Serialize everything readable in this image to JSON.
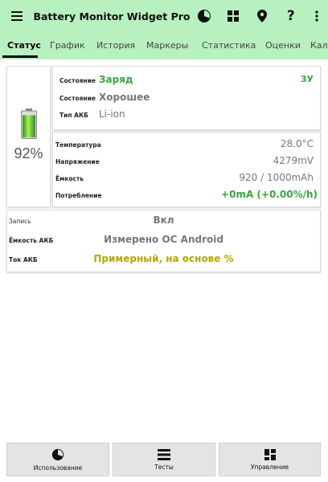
{
  "app": {
    "title": "Battery Monitor Widget Pro",
    "menu_icon": "hamburger-menu-icon",
    "actions": [
      {
        "icon": "pie-chart-icon"
      },
      {
        "icon": "widgets-grid-icon"
      },
      {
        "icon": "location-pin-icon"
      },
      {
        "label": "?",
        "icon": "help-icon"
      },
      {
        "icon": "more-vert-icon"
      }
    ],
    "accent_color": "#b8f0bf"
  },
  "tabs": [
    {
      "label": "Статус",
      "active": true
    },
    {
      "label": "График"
    },
    {
      "label": "История"
    },
    {
      "label": "Маркеры"
    },
    {
      "label": "Статистика"
    },
    {
      "label": "Оценки"
    },
    {
      "label": "Кал"
    }
  ],
  "battery": {
    "percent": "92%",
    "level": 0.92,
    "icon": "battery-icon"
  },
  "status": {
    "rows": [
      {
        "label": "Состояние",
        "value": "Заряд",
        "right": "ЗУ"
      },
      {
        "label": "Состояние",
        "value": "Хорошее"
      },
      {
        "label": "Тип АКБ",
        "value": "Li-ion"
      }
    ]
  },
  "params": {
    "rows": [
      {
        "label": "Температура",
        "value": "28.0°C"
      },
      {
        "label": "Напряжение",
        "value": "4279mV"
      },
      {
        "label": "Ёмкость",
        "value": "920 / 1000mAh"
      },
      {
        "label": "Потребление",
        "value": "+0mA (+0.00%/h)"
      }
    ]
  },
  "record": {
    "rows": [
      {
        "label": "Запись",
        "value": "Вкл"
      },
      {
        "label": "Ёмкость АКБ",
        "value": "Измерено ОС Android"
      },
      {
        "label": "Ток АКБ",
        "value": "Примерный, на основе %"
      }
    ]
  },
  "bottom": [
    {
      "label": "Использование",
      "icon": "pie-chart-icon"
    },
    {
      "label": "Тесты",
      "icon": "list-icon"
    },
    {
      "label": "Управление",
      "icon": "dashboard-grid-icon"
    }
  ]
}
